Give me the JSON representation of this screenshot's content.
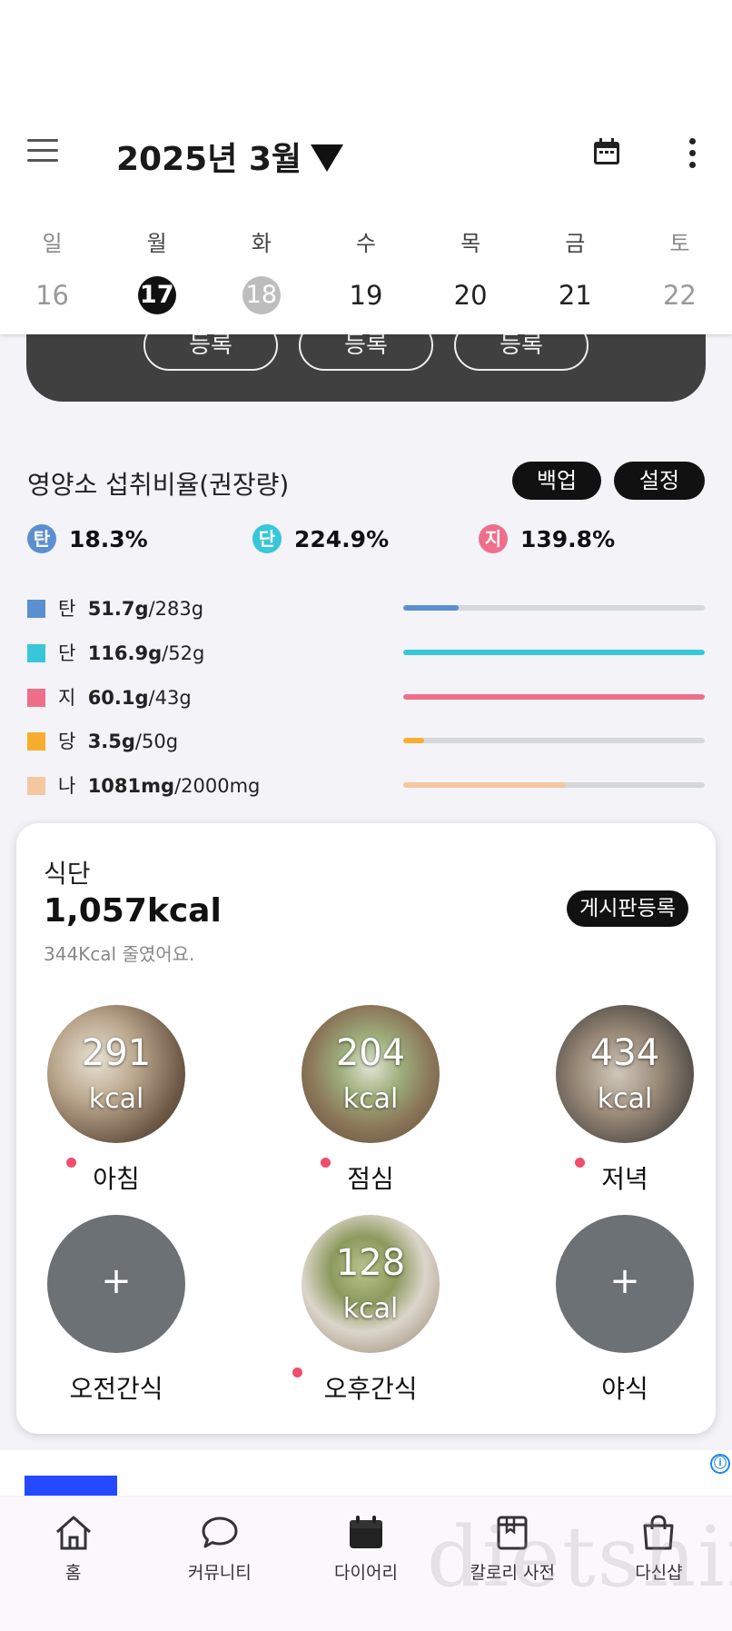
{
  "header": {
    "month_label": "2025년 3월",
    "weekdays": [
      "일",
      "월",
      "화",
      "수",
      "목",
      "금",
      "토"
    ],
    "dates": [
      "16",
      "17",
      "18",
      "19",
      "20",
      "21",
      "22"
    ],
    "selected_date": "17",
    "today_date": "18"
  },
  "top_card": {
    "buttons": [
      "등록",
      "등록",
      "등록"
    ]
  },
  "nutrition": {
    "title": "영양소 섭취비율(권장량)",
    "backup_label": "백업",
    "settings_label": "설정",
    "ratios": [
      {
        "badge": "탄",
        "value": "18.3%",
        "color": "#5b8fd0"
      },
      {
        "badge": "단",
        "value": "224.9%",
        "color": "#38c6d9"
      },
      {
        "badge": "지",
        "value": "139.8%",
        "color": "#ef6f8b"
      }
    ],
    "rows": [
      {
        "label": "탄",
        "amount": "51.7g",
        "target": "/283g",
        "color": "#5b8fd0",
        "progress": 0.183
      },
      {
        "label": "단",
        "amount": "116.9g",
        "target": "/52g",
        "color": "#38c6d9",
        "progress": 1.0
      },
      {
        "label": "지",
        "amount": "60.1g",
        "target": "/43g",
        "color": "#ef6f8b",
        "progress": 1.0
      },
      {
        "label": "당",
        "amount": "3.5g",
        "target": "/50g",
        "color": "#f7ae2e",
        "progress": 0.07
      },
      {
        "label": "나",
        "amount": "1081mg",
        "target": "/2000mg",
        "color": "#f5c79f",
        "progress": 0.54
      }
    ]
  },
  "meals": {
    "label": "식단",
    "total": "1,057kcal",
    "subtitle": "344Kcal 줄였어요.",
    "board_button": "게시판등록",
    "kcal_unit": "kcal",
    "plus": "+",
    "items": [
      {
        "name": "아침",
        "kcal": "291",
        "logged": true
      },
      {
        "name": "점심",
        "kcal": "204",
        "logged": true
      },
      {
        "name": "저녁",
        "kcal": "434",
        "logged": true
      },
      {
        "name": "오전간식",
        "kcal": "",
        "logged": false
      },
      {
        "name": "오후간식",
        "kcal": "128",
        "logged": true
      },
      {
        "name": "야식",
        "kcal": "",
        "logged": false
      }
    ]
  },
  "ad": {
    "info_icon": "ⓘ"
  },
  "bottom_nav": {
    "items": [
      {
        "label": "홈",
        "icon": "home-icon"
      },
      {
        "label": "커뮤니티",
        "icon": "chat-bubble-icon"
      },
      {
        "label": "다이어리",
        "icon": "calendar-icon"
      },
      {
        "label": "칼로리 사전",
        "icon": "book-icon"
      },
      {
        "label": "다신샵",
        "icon": "shopping-bag-icon"
      }
    ]
  },
  "watermark": "dietshin.com"
}
